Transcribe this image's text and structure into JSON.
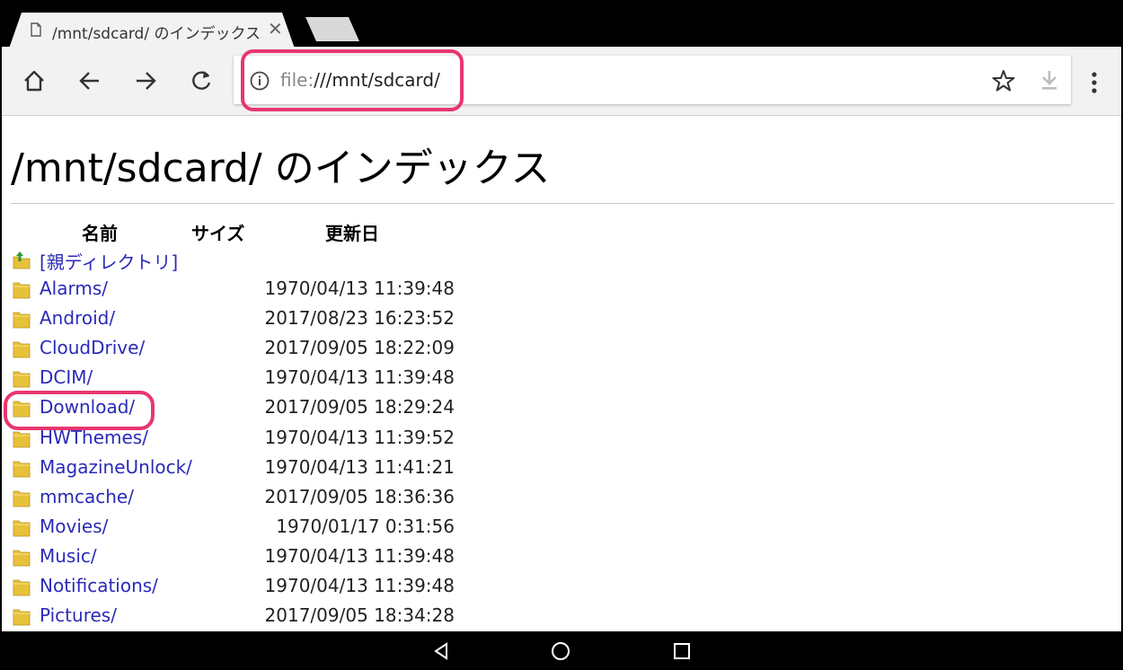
{
  "browser": {
    "tab": {
      "title": "/mnt/sdcard/ のインデックス",
      "close_symbol": "✕"
    },
    "omnibox": {
      "scheme": "file:",
      "path": "///mnt/sdcard/"
    }
  },
  "page": {
    "heading": "/mnt/sdcard/ のインデックス",
    "columns": {
      "name": "名前",
      "size": "サイズ",
      "modified": "更新日"
    },
    "parent_link": "[親ディレクトリ]",
    "entries": [
      {
        "name": "Alarms/",
        "modified": "1970/04/13 11:39:48"
      },
      {
        "name": "Android/",
        "modified": "2017/08/23 16:23:52"
      },
      {
        "name": "CloudDrive/",
        "modified": "2017/09/05 18:22:09"
      },
      {
        "name": "DCIM/",
        "modified": "1970/04/13 11:39:48"
      },
      {
        "name": "Download/",
        "modified": "2017/09/05 18:29:24"
      },
      {
        "name": "HWThemes/",
        "modified": "1970/04/13 11:39:52"
      },
      {
        "name": "MagazineUnlock/",
        "modified": "1970/04/13 11:41:21"
      },
      {
        "name": "mmcache/",
        "modified": "2017/09/05 18:36:36"
      },
      {
        "name": "Movies/",
        "modified": "1970/01/17 0:31:56"
      },
      {
        "name": "Music/",
        "modified": "1970/04/13 11:39:48"
      },
      {
        "name": "Notifications/",
        "modified": "1970/04/13 11:39:48"
      },
      {
        "name": "Pictures/",
        "modified": "2017/09/05 18:34:28"
      }
    ]
  },
  "colors": {
    "highlight": "#e8366f",
    "link": "#2a2ab8",
    "folder": "#e8c13a"
  }
}
